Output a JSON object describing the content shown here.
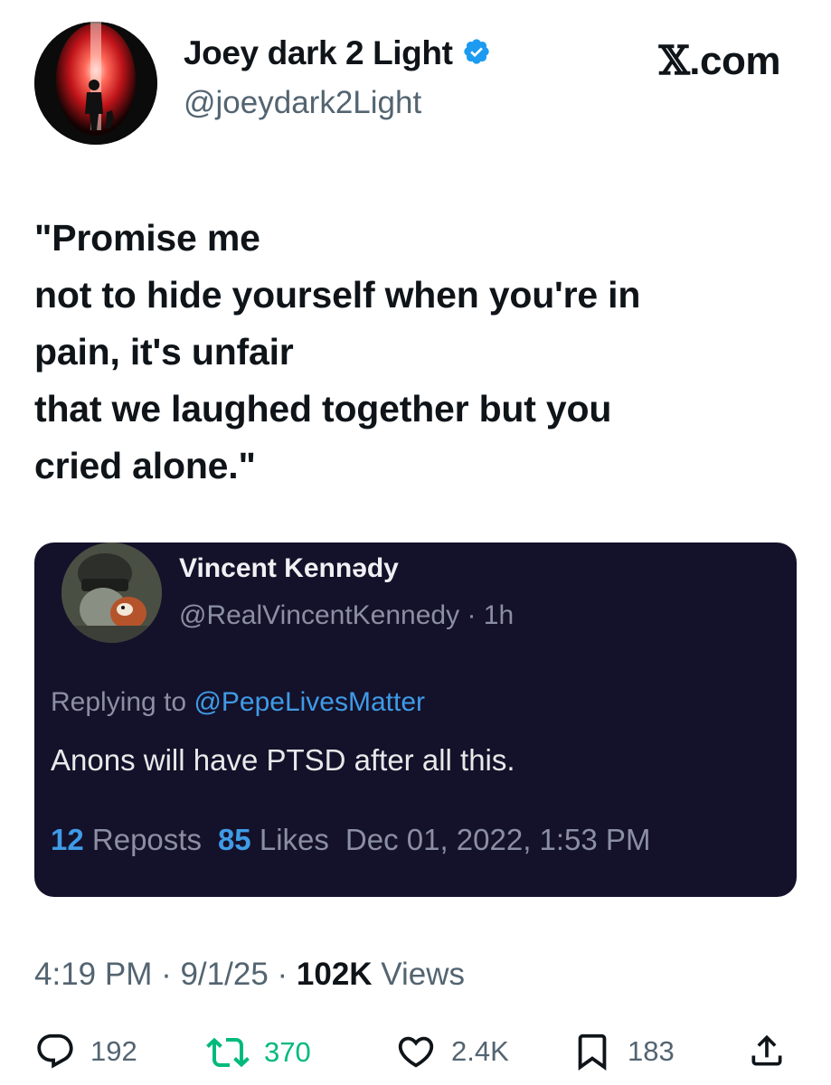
{
  "author": {
    "display_name": "Joey dark 2 Light",
    "handle": "@joeydark2Light",
    "verified": true
  },
  "site_logo": {
    "glyph": "𝕏",
    "text": ".com"
  },
  "post": {
    "lines": [
      "\"Promise me",
      "not to hide yourself when you're in",
      "pain, it's unfair",
      "that we laughed together but you",
      "cried alone.\""
    ]
  },
  "quoted": {
    "display_name": "Vincent Kennədy",
    "handle": "@RealVincentKennedy",
    "time": "1h",
    "replying_prefix": "Replying to",
    "replying_to": "@PepeLivesMatter",
    "text": "Anons will have PTSD after all this.",
    "reposts_count": "12",
    "reposts_label": "Reposts",
    "likes_count": "85",
    "likes_label": "Likes",
    "timestamp": "Dec 01, 2022, 1:53 PM"
  },
  "meta": {
    "time": "4:19 PM",
    "date": "9/1/25",
    "views_count": "102K",
    "views_label": "Views"
  },
  "actions": {
    "replies": "192",
    "reposts": "370",
    "likes": "2.4K",
    "bookmarks": "183"
  },
  "colors": {
    "text": "#0f1419",
    "secondary": "#536471",
    "verified_blue": "#1d9bf0",
    "repost_green": "#00ba7c",
    "quote_bg": "#14112a",
    "quote_accent": "#3f9be6"
  }
}
